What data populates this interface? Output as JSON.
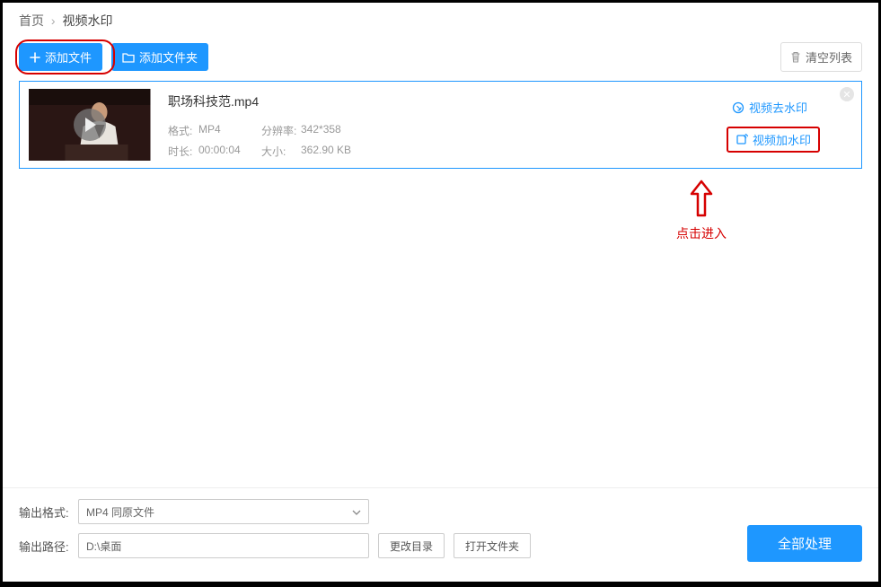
{
  "breadcrumb": {
    "home": "首页",
    "current": "视频水印"
  },
  "toolbar": {
    "add_file": "添加文件",
    "add_folder": "添加文件夹",
    "clear_list": "清空列表"
  },
  "file": {
    "name": "职场科技范.mp4",
    "format_label": "格式:",
    "format": "MP4",
    "resolution_label": "分辨率:",
    "resolution": "342*358",
    "duration_label": "时长:",
    "duration": "00:00:04",
    "size_label": "大小:",
    "size": "362.90 KB"
  },
  "ops": {
    "remove_watermark": "视频去水印",
    "add_watermark": "视频加水印"
  },
  "annotation": {
    "text": "点击进入"
  },
  "footer": {
    "out_format_label": "输出格式:",
    "out_format_value": "MP4  同原文件",
    "out_path_label": "输出路径:",
    "out_path_value": "D:\\桌面",
    "change_dir": "更改目录",
    "open_folder": "打开文件夹",
    "process_all": "全部处理"
  }
}
